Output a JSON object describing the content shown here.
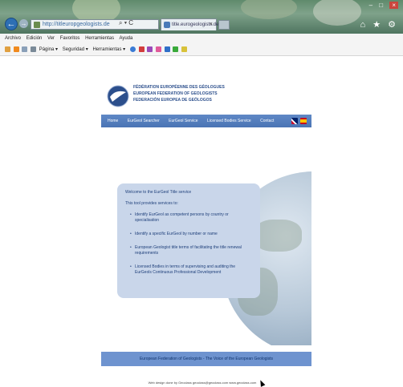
{
  "browser": {
    "address_url": "http://titleuropgeologists.de",
    "address_tools": "⌕ ▾ C",
    "tab_title": "title.eurogeologists.de",
    "tab_close": "×",
    "window_controls": "– □",
    "window_close": "×",
    "nav_icons": "⌂ ★ ⚙",
    "back_glyph": "←",
    "forward_glyph": "→"
  },
  "menu": {
    "items": [
      "Archivo",
      "Edición",
      "Ver",
      "Favoritos",
      "Herramientas",
      "Ayuda"
    ]
  },
  "commandbar": {
    "items": [
      "Página ▾",
      "Seguridad ▾",
      "Herramientas ▾"
    ]
  },
  "site": {
    "logo_lines": [
      "FÉDÉRATION EUROPÉENNE DES GÉOLOGUES",
      "EUROPEAN FEDERATION OF GEOLOGISTS",
      "FEDERACIÓN EUROPEA DE GEÓLOGOS"
    ],
    "nav": [
      "Home",
      "EurGeol Searcher",
      "EurGeol Service",
      "Licensed Bodies Service",
      "Contact"
    ],
    "panel": {
      "welcome": "Welcome to the EurGeol Title service",
      "intro": "This tool provides services to:",
      "bullets": [
        "Identify EurGeol as competent persons by country or specialisation",
        "Identify a specific EurGeol by number or name",
        "European Geologist title terms of facilitating the title renewal requirements",
        "Licensed Bodies in terms of supervising and auditing the EurGeols Continuous Professional Development"
      ]
    },
    "footer": "European Federation of Geologists - The Voice of the European Geologists",
    "credits": "Web design done by Geoclass   geoclass@geoclass.com   www.geoclass.com"
  },
  "colors": {
    "nav_bar": "#4a74b4",
    "panel_bg": "#c9d6ea",
    "footer_band": "#6e93cf",
    "titlebar": "#5f8a6c"
  }
}
